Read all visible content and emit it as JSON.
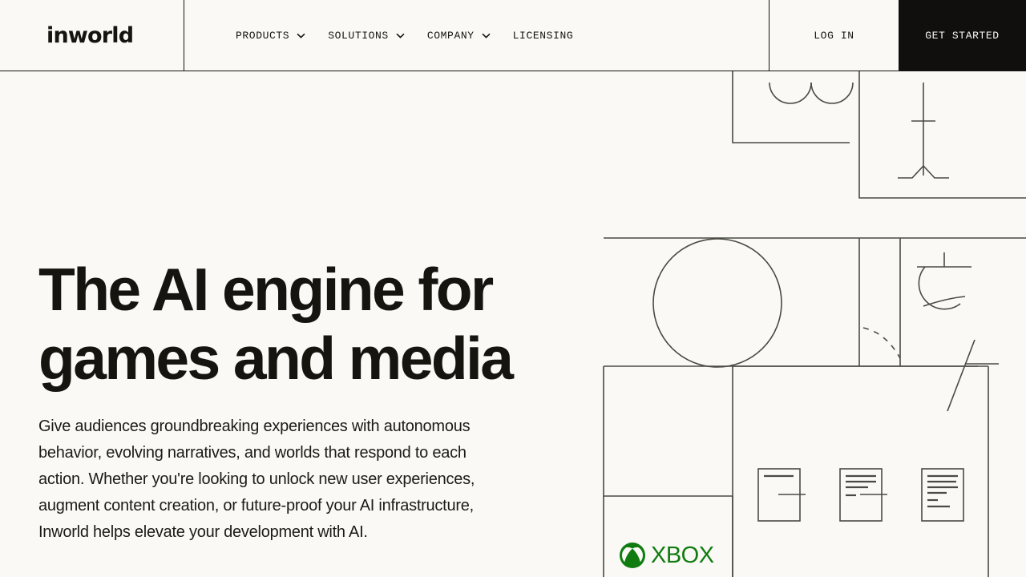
{
  "brand": {
    "logo_text": "inworld",
    "logo_icon": "inworld-wordmark"
  },
  "header": {
    "nav_items": [
      {
        "label": "PRODUCTS",
        "has_dropdown": true,
        "icon": "chevron-down-icon"
      },
      {
        "label": "SOLUTIONS",
        "has_dropdown": true,
        "icon": "chevron-down-icon"
      },
      {
        "label": "COMPANY",
        "has_dropdown": true,
        "icon": "chevron-down-icon"
      },
      {
        "label": "LICENSING",
        "has_dropdown": false,
        "icon": ""
      }
    ],
    "login_label": "LOG IN",
    "cta_label": "GET STARTED",
    "cta_background": "#100f0d",
    "cta_text_color": "#faf9f5"
  },
  "hero": {
    "title": "The AI engine for\ngames and media",
    "body": "Give audiences groundbreaking experiences with autonomous behavior, evolving narratives, and worlds that respond to each action. Whether you're looking to unlock new user experiences, augment content creation, or future-proof your AI infrastructure, Inworld helps elevate your development with AI."
  },
  "illustration": {
    "description": "abstract line-art grid with rectangles, circle, arcs, glyphs and document cards",
    "line_color": "#4a4a44",
    "partner_logo": {
      "name": "xbox-logo",
      "text": "XBOX",
      "color": "#107c10"
    }
  },
  "theme": {
    "background": "#faf9f5",
    "ink": "#15140f",
    "accent_green": "#107c10"
  }
}
